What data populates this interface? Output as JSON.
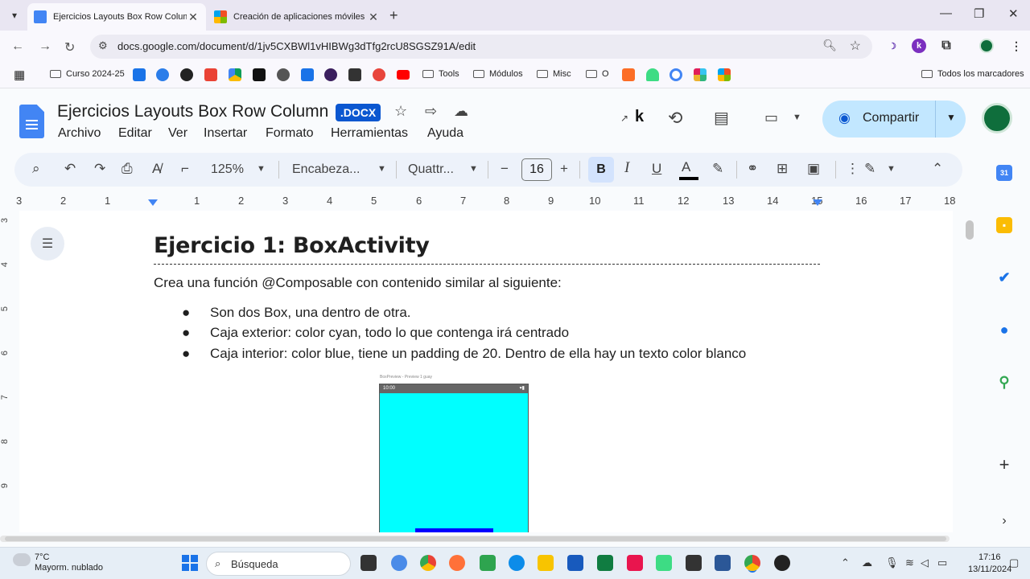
{
  "browser": {
    "tabs": [
      {
        "title": "Ejercicios Layouts Box Row Colum",
        "active": true,
        "favicon_color": "#4285f4"
      },
      {
        "title": "Creación de aplicaciones móviles y",
        "active": false,
        "favicon_color": "#ea4335"
      }
    ],
    "url": "docs.google.com/document/d/1jv5CXBWl1vHIBWg3dTfg2rcU8SGSZ91A/edit",
    "bookmarks": {
      "folder_curso": "Curso 2024-25",
      "tools": "Tools",
      "modulos": "Módulos",
      "misc": "Misc",
      "o": "O",
      "all_bookmarks": "Todos los marcadores"
    }
  },
  "document": {
    "title": "Ejercicios Layouts Box Row Column",
    "badge": ".DOCX",
    "menus": [
      "Archivo",
      "Editar",
      "Ver",
      "Insertar",
      "Formato",
      "Herramientas",
      "Ayuda"
    ],
    "share_label": "Compartir",
    "toolbar": {
      "zoom": "125%",
      "style": "Encabeza...",
      "font": "Quattr...",
      "font_size": "16"
    },
    "ruler_numbers": [
      "3",
      "2",
      "1",
      "1",
      "2",
      "3",
      "4",
      "5",
      "6",
      "7",
      "8",
      "9",
      "10",
      "11",
      "12",
      "13",
      "14",
      "15",
      "16",
      "17",
      "18"
    ],
    "vruler_numbers": [
      "3",
      "4",
      "5",
      "6",
      "7",
      "8",
      "9"
    ],
    "heading": "Ejercicio 1: BoxActivity",
    "intro": "Crea una función @Composable con contenido similar al siguiente:",
    "bullets": [
      "Son dos Box, una dentro de otra.",
      "Caja exterior: color cyan, todo lo que contenga irá centrado",
      "Caja interior: color blue, tiene un padding de 20. Dentro de ella hay un texto color blanco"
    ],
    "preview": {
      "label": "BoxPreview - Preview 1 guay",
      "status_time": "10:00",
      "outer_color": "#00ffff",
      "inner_color": "#0000ff"
    }
  },
  "taskbar": {
    "weather_temp": "7°C",
    "weather_desc": "Mayorm. nublado",
    "search_placeholder": "Búsqueda",
    "time": "17:16",
    "date": "13/11/2024"
  }
}
